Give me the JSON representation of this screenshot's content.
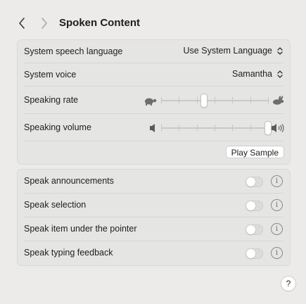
{
  "header": {
    "title": "Spoken Content",
    "back_icon": "chevron-left-icon",
    "forward_icon": "chevron-right-icon"
  },
  "speech": {
    "language_label": "System speech language",
    "language_value": "Use System Language",
    "voice_label": "System voice",
    "voice_value": "Samantha",
    "rate_label": "Speaking rate",
    "rate_level": 0.4,
    "rate_icon_slow": "turtle-icon",
    "rate_icon_fast": "hare-icon",
    "volume_label": "Speaking volume",
    "volume_level": 1.0,
    "volume_icon_low": "speaker-low-icon",
    "volume_icon_high": "speaker-high-icon",
    "play_sample_label": "Play Sample"
  },
  "options": [
    {
      "label": "Speak announcements",
      "enabled": false
    },
    {
      "label": "Speak selection",
      "enabled": false
    },
    {
      "label": "Speak item under the pointer",
      "enabled": false
    },
    {
      "label": "Speak typing feedback",
      "enabled": false
    }
  ],
  "info_glyph": "i",
  "help_label": "?"
}
